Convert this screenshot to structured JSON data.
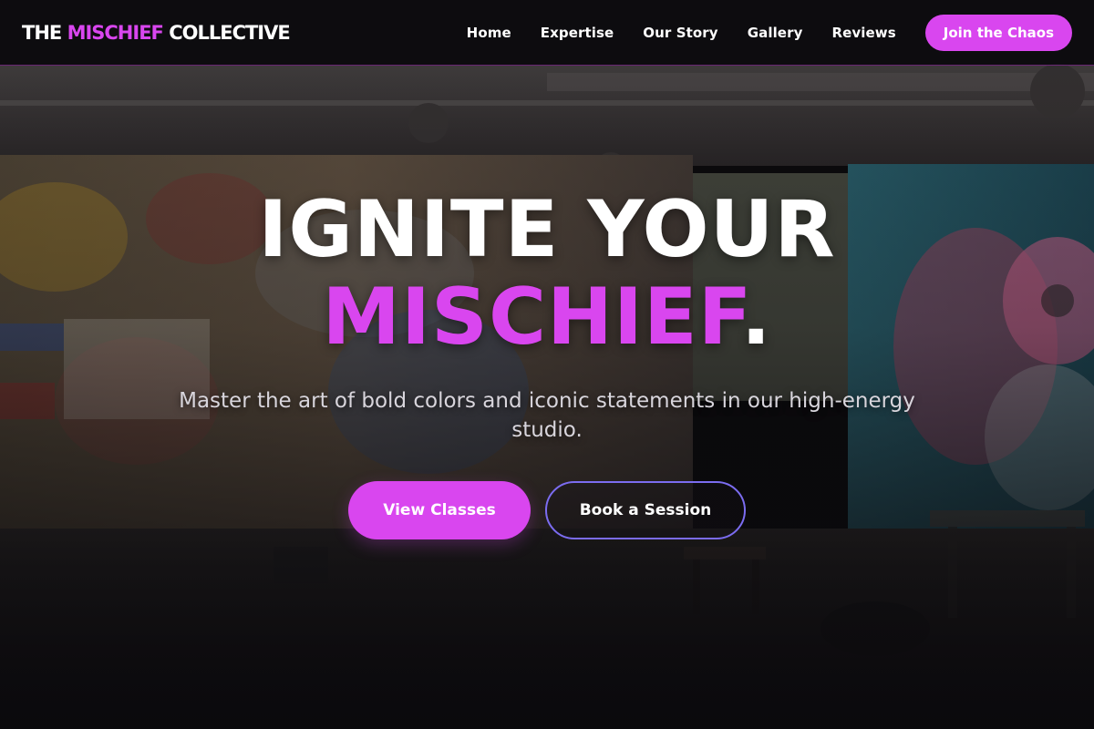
{
  "brand": {
    "logo_prefix": "THE ",
    "logo_accent": "MISCHIEF",
    "logo_suffix": " COLLECTIVE"
  },
  "nav": {
    "items": [
      {
        "label": "Home"
      },
      {
        "label": "Expertise"
      },
      {
        "label": "Our Story"
      },
      {
        "label": "Gallery"
      },
      {
        "label": "Reviews"
      }
    ],
    "cta_label": "Join the Chaos"
  },
  "hero": {
    "title_line1": "IGNITE YOUR",
    "title_accent": "MISCHIEF",
    "title_period": ".",
    "subtitle": "Master the art of bold colors and iconic statements in our high-energy studio.",
    "primary_button": "View Classes",
    "secondary_button": "Book a Session",
    "background_description_icon": "graffiti-studio-photo"
  },
  "colors": {
    "accent": "#d946ef",
    "header_bg": "#0e0d10",
    "secondary_border": "#7b6cf0",
    "text_primary": "#ffffff",
    "text_muted": "#d8d5dc"
  }
}
